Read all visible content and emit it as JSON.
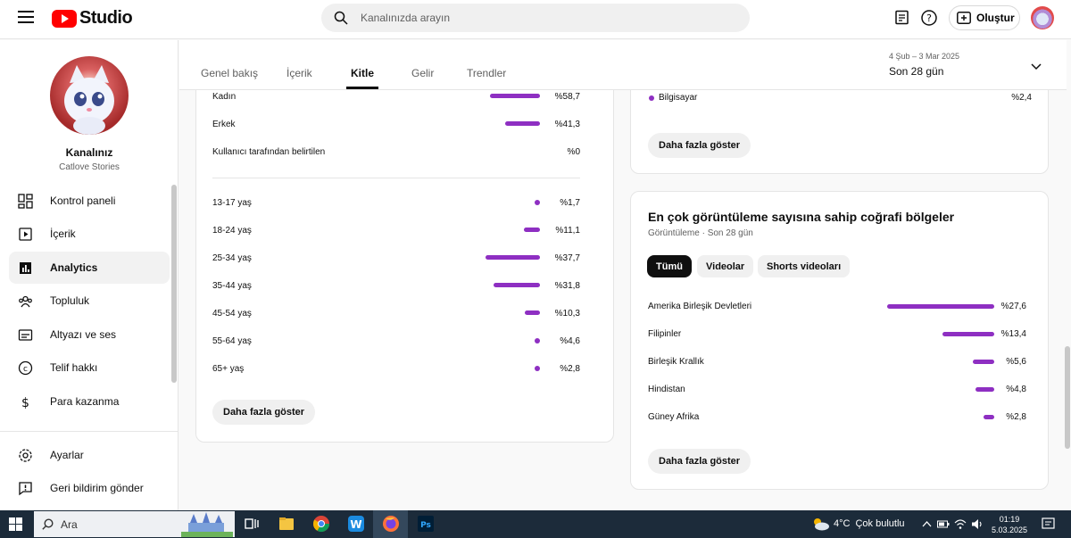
{
  "app": {
    "logo_text": "Studio"
  },
  "header": {
    "search_placeholder": "Kanalınızda arayın",
    "create_label": "Oluştur"
  },
  "channel": {
    "name": "Kanalınız",
    "subtitle": "Catlove Stories"
  },
  "sidebar": {
    "items": [
      {
        "label": "Kontrol paneli",
        "icon": "dashboard-icon"
      },
      {
        "label": "İçerik",
        "icon": "content-icon"
      },
      {
        "label": "Analytics",
        "icon": "analytics-icon",
        "active": true
      },
      {
        "label": "Topluluk",
        "icon": "community-icon"
      },
      {
        "label": "Altyazı ve ses",
        "icon": "subtitles-icon"
      },
      {
        "label": "Telif hakkı",
        "icon": "copyright-icon"
      },
      {
        "label": "Para kazanma",
        "icon": "monetization-icon"
      }
    ],
    "bottom_items": [
      {
        "label": "Ayarlar",
        "icon": "gear-icon"
      },
      {
        "label": "Geri bildirim gönder",
        "icon": "feedback-icon"
      }
    ]
  },
  "tabs": [
    {
      "label": "Genel bakış"
    },
    {
      "label": "İçerik"
    },
    {
      "label": "Kitle",
      "active": true
    },
    {
      "label": "Gelir"
    },
    {
      "label": "Trendler"
    }
  ],
  "date": {
    "range": "4 Şub – 3 Mar 2025",
    "label": "Son 28 gün"
  },
  "gender": [
    {
      "label": "Kadın",
      "value": "%58,7",
      "pct": 58.7
    },
    {
      "label": "Erkek",
      "value": "%41,3",
      "pct": 41.3
    },
    {
      "label": "Kullanıcı tarafından belirtilen",
      "value": "%0",
      "pct": 0
    }
  ],
  "age": [
    {
      "label": "13-17 yaş",
      "value": "%1,7",
      "pct": 1.7
    },
    {
      "label": "18-24 yaş",
      "value": "%11,1",
      "pct": 11.1
    },
    {
      "label": "25-34 yaş",
      "value": "%37,7",
      "pct": 37.7
    },
    {
      "label": "35-44 yaş",
      "value": "%31,8",
      "pct": 31.8
    },
    {
      "label": "45-54 yaş",
      "value": "%10,3",
      "pct": 10.3
    },
    {
      "label": "55-64 yaş",
      "value": "%4,6",
      "pct": 4.6
    },
    {
      "label": "65+ yaş",
      "value": "%2,8",
      "pct": 2.8
    }
  ],
  "more_label": "Daha fazla göster",
  "device": {
    "label": "Bilgisayar",
    "value": "%2,4"
  },
  "geo": {
    "title": "En çok görüntüleme sayısına sahip coğrafi bölgeler",
    "subtitle": "Görüntüleme · Son 28 gün",
    "chips": [
      "Tümü",
      "Videolar",
      "Shorts videoları"
    ],
    "rows": [
      {
        "label": "Amerika Birleşik Devletleri",
        "value": "%27,6",
        "pct": 27.6
      },
      {
        "label": "Filipinler",
        "value": "%13,4",
        "pct": 13.4
      },
      {
        "label": "Birleşik Krallık",
        "value": "%5,6",
        "pct": 5.6
      },
      {
        "label": "Hindistan",
        "value": "%4,8",
        "pct": 4.8
      },
      {
        "label": "Güney Afrika",
        "value": "%2,8",
        "pct": 2.8
      }
    ]
  },
  "taskbar": {
    "search_label": "Ara",
    "temp": "4°C",
    "weather": "Çok bulutlu",
    "time": "01:19",
    "date": "5.03.2025"
  }
}
